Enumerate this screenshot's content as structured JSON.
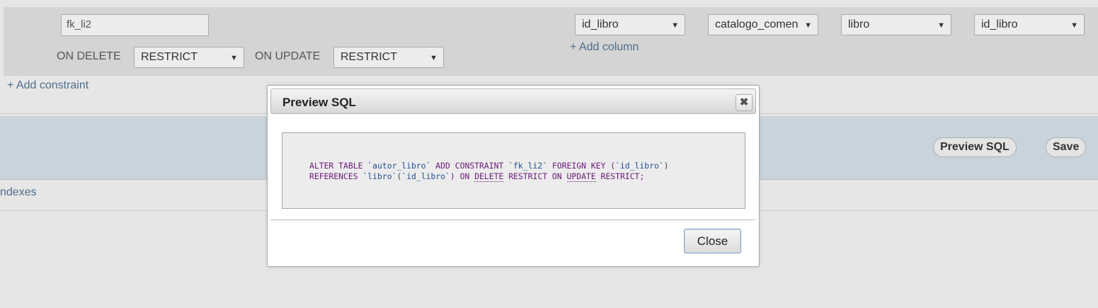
{
  "constraint": {
    "name_value": "fk_li2",
    "on_delete_label": "ON DELETE",
    "on_delete_value": "RESTRICT",
    "on_update_label": "ON UPDATE",
    "on_update_value": "RESTRICT",
    "column_select": "id_libro",
    "ref_database": "catalogo_comen",
    "ref_table": "libro",
    "ref_column": "id_libro",
    "add_column": "+ Add column",
    "add_constraint": "+ Add constraint"
  },
  "actions": {
    "preview_sql": "Preview SQL",
    "save": "Save"
  },
  "indexes_label": "ndexes",
  "dialog": {
    "title": "Preview SQL",
    "close_label": "Close",
    "sql": {
      "l1": [
        "ALTER TABLE ",
        "`autor_libro`",
        " ADD CONSTRAINT ",
        "`fk_li2`",
        " FOREIGN KEY (",
        "`id_libro`",
        ")"
      ],
      "l2": [
        "REFERENCES ",
        "`libro`",
        "(",
        "`id_libro`",
        ") ON ",
        "DELETE",
        " RESTRICT ON ",
        "UPDATE",
        " RESTRICT;"
      ]
    }
  },
  "icons": {
    "dropdown": "chevron-down-icon",
    "dialog_close": "close-icon"
  },
  "colors": {
    "link": "#4d6d8c",
    "keyword": "#6b1a7a",
    "identifier": "#1f4f8f",
    "blue_bar": "#c8d3db"
  }
}
